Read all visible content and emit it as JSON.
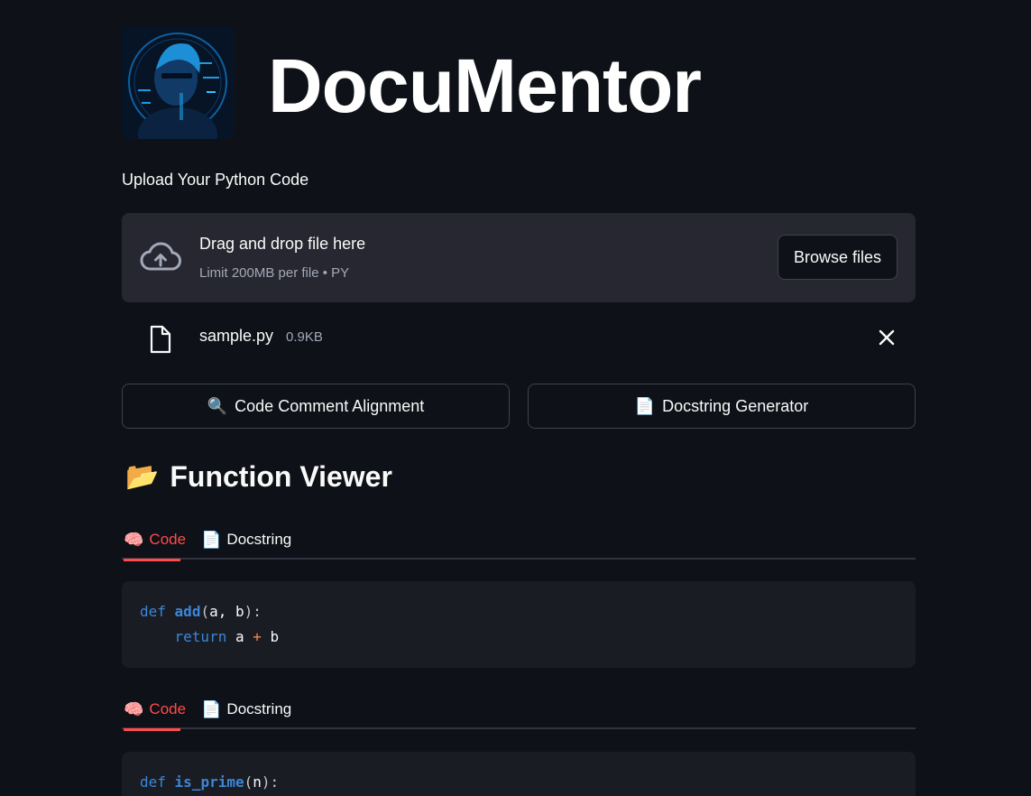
{
  "app": {
    "title": "DocuMentor",
    "logo_alt": "avatar"
  },
  "uploader": {
    "label": "Upload Your Python Code",
    "drop_title": "Drag and drop file here",
    "limit_text": "Limit 200MB per file • PY",
    "browse_label": "Browse files",
    "file": {
      "name": "sample.py",
      "size": "0.9KB"
    }
  },
  "actions": {
    "left": {
      "icon": "🔍",
      "label": "Code Comment Alignment"
    },
    "right": {
      "icon": "📄",
      "label": "Docstring Generator"
    }
  },
  "viewer": {
    "icon": "📂",
    "title": "Function Viewer",
    "blocks": [
      {
        "tabs": [
          {
            "icon": "🧠",
            "label": "Code",
            "active": true
          },
          {
            "icon": "📄",
            "label": "Docstring",
            "active": false
          }
        ],
        "code": {
          "kw1": "def",
          "name": "add",
          "params": "a, b",
          "line2_kw": "return",
          "line2_a": "a",
          "line2_op": "+",
          "line2_b": "b"
        }
      },
      {
        "tabs": [
          {
            "icon": "🧠",
            "label": "Code",
            "active": true
          },
          {
            "icon": "📄",
            "label": "Docstring",
            "active": false
          }
        ],
        "code": {
          "kw1": "def",
          "name": "is_prime",
          "params": "n"
        }
      }
    ]
  },
  "colors": {
    "background": "#0e1117",
    "accent": "#ff4b4b",
    "panel": "#262730",
    "code_bg": "#1a1c24"
  }
}
